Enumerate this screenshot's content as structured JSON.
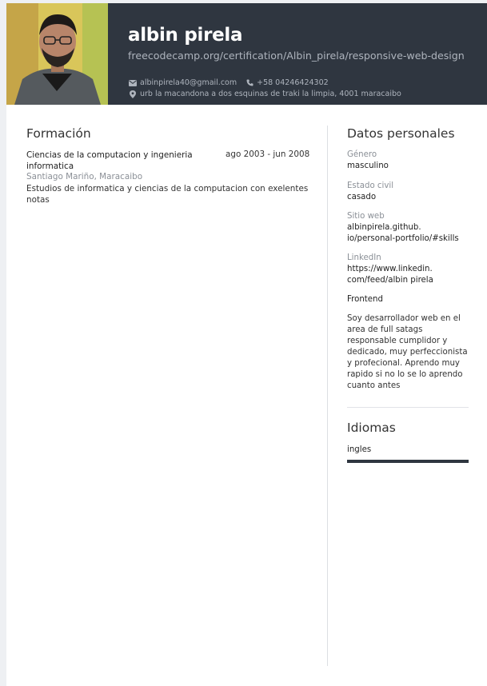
{
  "header": {
    "name": "albin pirela",
    "url": "freecodecamp.org/certification/Albin_pirela/responsive-web-design",
    "email": "albinpirela40@gmail.com",
    "phone": "+58 04246424302",
    "address": "urb la macandona a dos esquinas de traki la limpia, 4001 maracaibo",
    "colors": {
      "header_bg": "#2f3640",
      "muted": "#aeb4bd"
    }
  },
  "education": {
    "title": "Formación",
    "item": {
      "title": "Ciencias de la computacion y ingenieria informatica",
      "dates": "ago 2003 - jun 2008",
      "place": "Santiago Mariño, Maracaibo",
      "description": "Estudios de informatica y ciencias de la computacion con exelentes notas"
    }
  },
  "personal": {
    "title": "Datos personales",
    "gender_label": "Género",
    "gender": "masculino",
    "civil_label": "Estado civil",
    "civil": "casado",
    "web_label": "Sitio web",
    "web_1": "albinpirela.github.",
    "web_2": "io/personal-portfolio/#skills",
    "linkedin_label": "LinkedIn",
    "linkedin_1": "https://www.linkedin.",
    "linkedin_2": "com/feed/albin pirela",
    "role": "Frontend",
    "summary": "Soy desarrollador web en el area de full satags responsable cumplidor y dedicado, muy perfeccionista y profecional. Aprendo muy rapido si no lo se lo aprendo cuanto antes"
  },
  "languages": {
    "title": "Idiomas",
    "items": [
      {
        "name": "ingles",
        "level": 1.0
      }
    ]
  },
  "icons": {
    "email": "envelope-icon",
    "phone": "phone-icon",
    "address": "map-marker-icon"
  }
}
